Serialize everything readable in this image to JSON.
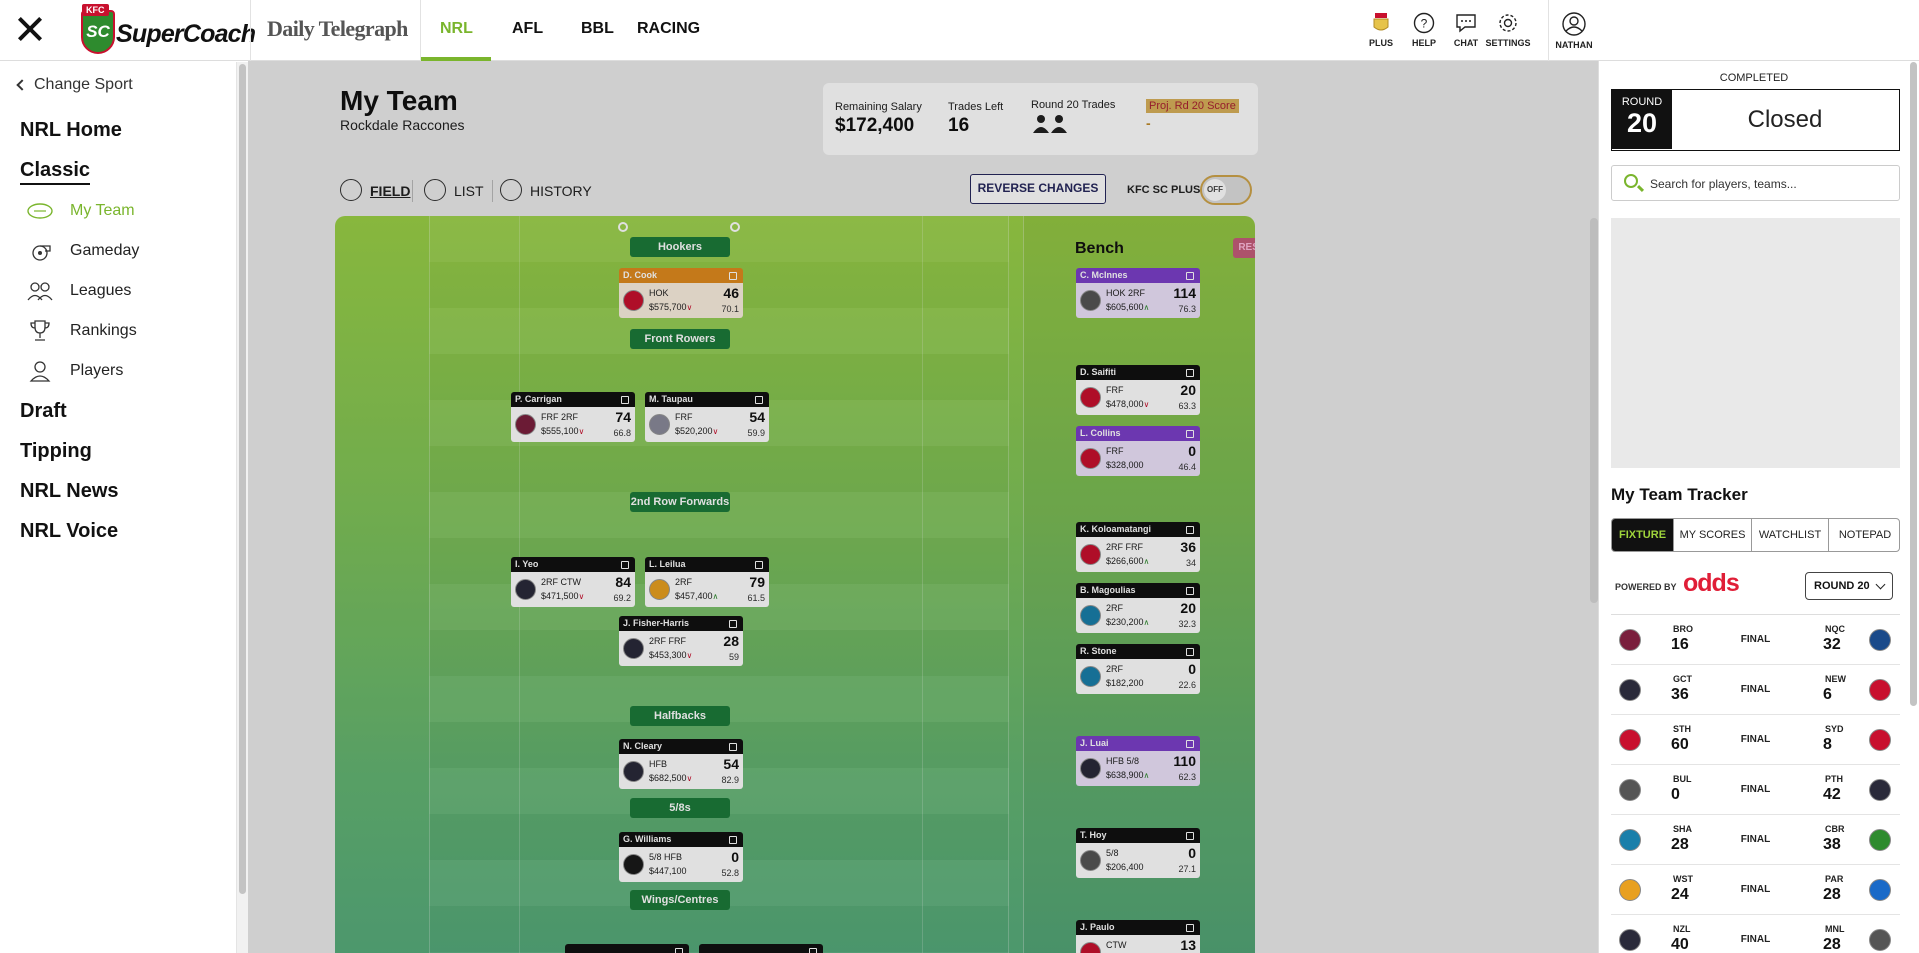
{
  "header": {
    "brand": "SuperCoach",
    "brand_badge": "KFC",
    "brand_mark": "SC",
    "partner": "Daily Telegraph",
    "sports": [
      {
        "label": "NRL",
        "active": true
      },
      {
        "label": "AFL",
        "active": false
      },
      {
        "label": "BBL",
        "active": false
      },
      {
        "label": "RACING",
        "active": false
      }
    ],
    "utilities": [
      {
        "label": "PLUS",
        "icon": "kfc-plus-icon"
      },
      {
        "label": "HELP",
        "icon": "help-icon"
      },
      {
        "label": "CHAT",
        "icon": "chat-icon"
      },
      {
        "label": "SETTINGS",
        "icon": "gear-icon"
      },
      {
        "label": "NATHAN",
        "icon": "user-icon"
      }
    ]
  },
  "sidebar": {
    "change_sport": "Change Sport",
    "sections": [
      "NRL Home",
      "Classic",
      "Draft",
      "Tipping",
      "NRL News",
      "NRL Voice"
    ],
    "classic_items": [
      {
        "label": "My Team",
        "icon": "field-icon",
        "active": true
      },
      {
        "label": "Gameday",
        "icon": "whistle-icon",
        "active": false
      },
      {
        "label": "Leagues",
        "icon": "users-icon",
        "active": false
      },
      {
        "label": "Rankings",
        "icon": "trophy-icon",
        "active": false
      },
      {
        "label": "Players",
        "icon": "user-icon",
        "active": false
      }
    ]
  },
  "main": {
    "title": "My Team",
    "team_name": "Rockdale Raccones",
    "stats": {
      "salary_label": "Remaining Salary",
      "salary_value": "$172,400",
      "trades_label": "Trades Left",
      "trades_value": "16",
      "round_trades_label": "Round 20 Trades",
      "proj_label": "Proj. Rd 20 Score",
      "proj_value": "-"
    },
    "view_tabs": [
      {
        "label": "FIELD",
        "icon": "field-icon",
        "active": true
      },
      {
        "label": "LIST",
        "icon": "list-icon",
        "active": false
      },
      {
        "label": "HISTORY",
        "icon": "history-icon",
        "active": false
      }
    ],
    "reverse_label": "REVERSE CHANGES",
    "plus_label": "KFC SC PLUS",
    "toggle_state": "OFF",
    "positions": {
      "hookers": "Hookers",
      "front_rowers": "Front Rowers",
      "second_row": "2nd Row Forwards",
      "halfbacks": "Halfbacks",
      "five_eighths": "5/8s",
      "wings": "Wings/Centres"
    },
    "bench_title": "Bench",
    "reset_label": "RESET R",
    "field_players": [
      {
        "name": "D. Cook",
        "pos": "HOK",
        "price": "$575,700",
        "trend": "down",
        "score": "46",
        "avg": "70.1",
        "style": "captain",
        "team_color": "#c8102e"
      },
      {
        "name": "P. Carrigan",
        "pos": "FRF  2RF",
        "price": "$555,100",
        "trend": "down",
        "score": "74",
        "avg": "66.8",
        "style": "normal",
        "team_color": "#7a1f3d"
      },
      {
        "name": "M. Taupau",
        "pos": "FRF",
        "price": "$520,200",
        "trend": "down",
        "score": "54",
        "avg": "59.9",
        "style": "normal",
        "team_color": "#8a8a9a"
      },
      {
        "name": "I. Yeo",
        "pos": "2RF  CTW",
        "price": "$471,500",
        "trend": "down",
        "score": "84",
        "avg": "69.2",
        "style": "normal",
        "team_color": "#2a2a3a"
      },
      {
        "name": "L. Leilua",
        "pos": "2RF",
        "price": "$457,400",
        "trend": "up",
        "score": "79",
        "avg": "61.5",
        "style": "normal",
        "team_color": "#e8a020"
      },
      {
        "name": "J. Fisher-Harris",
        "pos": "2RF  FRF",
        "price": "$453,300",
        "trend": "down",
        "score": "28",
        "avg": "59",
        "style": "normal",
        "team_color": "#2a2a3a"
      },
      {
        "name": "N. Cleary",
        "pos": "HFB",
        "price": "$682,500",
        "trend": "down",
        "score": "54",
        "avg": "82.9",
        "style": "normal",
        "team_color": "#2a2a3a"
      },
      {
        "name": "G. Williams",
        "pos": "5/8  HFB",
        "price": "$447,100",
        "trend": "none",
        "score": "0",
        "avg": "52.8",
        "style": "normal",
        "team_color": "#1a1a1a"
      }
    ],
    "bench_players": [
      {
        "name": "C. McInnes",
        "pos": "HOK 2RF",
        "price": "$605,600",
        "trend": "up",
        "score": "114",
        "avg": "76.3",
        "style": "vice",
        "team_color": "#555"
      },
      {
        "name": "D. Saifiti",
        "pos": "FRF",
        "price": "$478,000",
        "trend": "down",
        "score": "20",
        "avg": "63.3",
        "style": "normal",
        "team_color": "#c8102e"
      },
      {
        "name": "L. Collins",
        "pos": "FRF",
        "price": "$328,000",
        "trend": "none",
        "score": "0",
        "avg": "46.4",
        "style": "vice",
        "team_color": "#c8102e"
      },
      {
        "name": "K. Koloamatangi",
        "pos": "2RF  FRF",
        "price": "$266,600",
        "trend": "up",
        "score": "36",
        "avg": "34",
        "style": "normal",
        "team_color": "#c8102e"
      },
      {
        "name": "B. Magoulias",
        "pos": "2RF",
        "price": "$230,200",
        "trend": "up",
        "score": "20",
        "avg": "32.3",
        "style": "normal",
        "team_color": "#1a7faa"
      },
      {
        "name": "R. Stone",
        "pos": "2RF",
        "price": "$182,200",
        "trend": "none",
        "score": "0",
        "avg": "22.6",
        "style": "normal",
        "team_color": "#1a7faa"
      },
      {
        "name": "J. Luai",
        "pos": "HFB  5/8",
        "price": "$638,900",
        "trend": "up",
        "score": "110",
        "avg": "62.3",
        "style": "vice",
        "team_color": "#2a2a3a"
      },
      {
        "name": "T. Hoy",
        "pos": "5/8",
        "price": "$206,400",
        "trend": "none",
        "score": "0",
        "avg": "27.1",
        "style": "normal",
        "team_color": "#555"
      },
      {
        "name": "J. Paulo",
        "pos": "CTW",
        "price": "",
        "trend": "none",
        "score": "13",
        "avg": "",
        "style": "normal",
        "team_color": "#c8102e"
      }
    ]
  },
  "right_panel": {
    "status": "COMPLETED",
    "round_label": "ROUND",
    "round_number": "20",
    "round_status": "Closed",
    "search_placeholder": "Search for players, teams...",
    "tracker_title": "My Team Tracker",
    "tracker_tabs": [
      {
        "label": "FIXTURE",
        "active": true
      },
      {
        "label": "MY SCORES",
        "active": false
      },
      {
        "label": "WATCHLIST",
        "active": false
      },
      {
        "label": "NOTEPAD",
        "active": false
      }
    ],
    "powered_by": "POWERED BY",
    "odds_brand": "odds",
    "round_select": "ROUND 20",
    "fixtures": [
      {
        "home": "BRO",
        "home_score": "16",
        "status": "FINAL",
        "away": "NQC",
        "away_score": "32",
        "home_color": "#7a1f3d",
        "away_color": "#1a4a8a"
      },
      {
        "home": "GCT",
        "home_score": "36",
        "status": "FINAL",
        "away": "NEW",
        "away_score": "6",
        "home_color": "#2a2a3a",
        "away_color": "#c8102e"
      },
      {
        "home": "STH",
        "home_score": "60",
        "status": "FINAL",
        "away": "SYD",
        "away_score": "8",
        "home_color": "#c8102e",
        "away_color": "#c8102e"
      },
      {
        "home": "BUL",
        "home_score": "0",
        "status": "FINAL",
        "away": "PTH",
        "away_score": "42",
        "home_color": "#555",
        "away_color": "#2a2a3a"
      },
      {
        "home": "SHA",
        "home_score": "28",
        "status": "FINAL",
        "away": "CBR",
        "away_score": "38",
        "home_color": "#1a7faa",
        "away_color": "#2e8b2e"
      },
      {
        "home": "WST",
        "home_score": "24",
        "status": "FINAL",
        "away": "PAR",
        "away_score": "28",
        "home_color": "#e8a020",
        "away_color": "#1a6ac8"
      },
      {
        "home": "NZL",
        "home_score": "40",
        "status": "FINAL",
        "away": "MNL",
        "away_score": "28",
        "home_color": "#2a2a3a",
        "away_color": "#555"
      }
    ]
  }
}
